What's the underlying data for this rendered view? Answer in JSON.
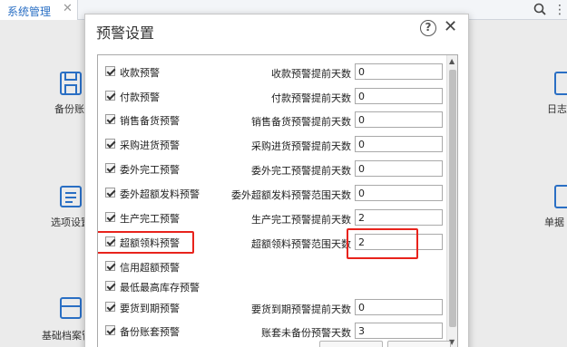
{
  "topbar": {
    "tab_label": "系统管理",
    "close_glyph": "✕",
    "more_glyph": "⋮"
  },
  "tiles": [
    {
      "label": "备份账套",
      "icon": "backup-icon"
    },
    {
      "label": "选项设置",
      "icon": "options-icon"
    },
    {
      "label": "基础档案管理",
      "icon": "archive-icon"
    },
    {
      "label": "日志",
      "icon": "log-icon"
    },
    {
      "label": "单据",
      "icon": "document-icon"
    }
  ],
  "dialog": {
    "title": "预警设置",
    "help_glyph": "?",
    "close_glyph": "✕",
    "rows": [
      {
        "label": "收款预警",
        "checked": true,
        "days_label": "收款预警提前天数",
        "days": "0"
      },
      {
        "label": "付款预警",
        "checked": true,
        "days_label": "付款预警提前天数",
        "days": "0"
      },
      {
        "label": "销售备货预警",
        "checked": true,
        "days_label": "销售备货预警提前天数",
        "days": "0"
      },
      {
        "label": "采购进货预警",
        "checked": true,
        "days_label": "采购进货预警提前天数",
        "days": "0"
      },
      {
        "label": "委外完工预警",
        "checked": true,
        "days_label": "委外完工预警提前天数",
        "days": "0"
      },
      {
        "label": "委外超额发料预警",
        "checked": true,
        "days_label": "委外超额发料预警范围天数",
        "days": "0"
      },
      {
        "label": "生产完工预警",
        "checked": true,
        "days_label": "生产完工预警提前天数",
        "days": "2"
      },
      {
        "label": "超额领料预警",
        "checked": true,
        "days_label": "超额领料预警范围天数",
        "days": "2"
      },
      {
        "label": "信用超额预警",
        "checked": true
      },
      {
        "label": "最低最高库存预警",
        "checked": true
      },
      {
        "label": "要货到期预警",
        "checked": true,
        "days_label": "要货到期预警提前天数",
        "days": "0"
      },
      {
        "label": "备份账套预警",
        "checked": true,
        "days_label": "账套未备份预警天数",
        "days": "3"
      }
    ],
    "scroll_up": "▲",
    "scroll_down": "▼"
  },
  "colors": {
    "accent": "#2a6fc4",
    "highlight": "#e8231c"
  }
}
